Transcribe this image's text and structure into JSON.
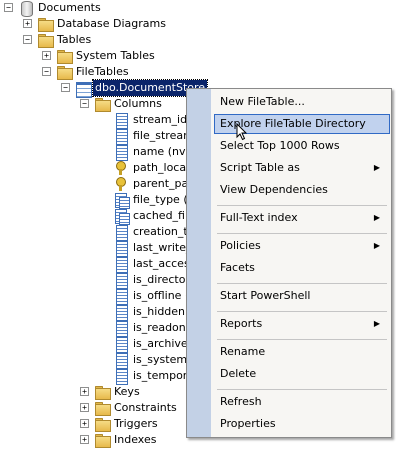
{
  "tree": {
    "documents": "Documents",
    "database_diagrams": "Database Diagrams",
    "tables": "Tables",
    "system_tables": "System Tables",
    "filetables": "FileTables",
    "selected_table": "dbo.DocumentStore",
    "columns": "Columns",
    "column_items": [
      "stream_id (",
      "file_stream",
      "name (nva",
      "path_locat",
      "parent_pat",
      "file_type (C",
      "cached_file",
      "creation_ti",
      "last_write_",
      "last_access",
      "is_director",
      "is_offline (",
      "is_hidden (",
      "is_readonly",
      "is_archive",
      "is_system (",
      "is_tempora"
    ],
    "parent_path_tail": ")",
    "keys": "Keys",
    "constraints": "Constraints",
    "triggers": "Triggers",
    "indexes": "Indexes"
  },
  "context_menu": {
    "new_filetable": "New FileTable...",
    "explore_filetable_directory": "Explore FileTable Directory",
    "select_top_1000": "Select Top 1000 Rows",
    "script_table_as": "Script Table as",
    "view_dependencies": "View Dependencies",
    "full_text_index": "Full-Text index",
    "policies": "Policies",
    "facets": "Facets",
    "start_powershell": "Start PowerShell",
    "reports": "Reports",
    "rename": "Rename",
    "delete": "Delete",
    "refresh": "Refresh",
    "properties": "Properties",
    "submenu_arrow": "▶"
  },
  "colors": {
    "selection": "#0a246a",
    "menu_highlight": "#c1d2ee",
    "menu_stripe": "#c3d1e6"
  }
}
